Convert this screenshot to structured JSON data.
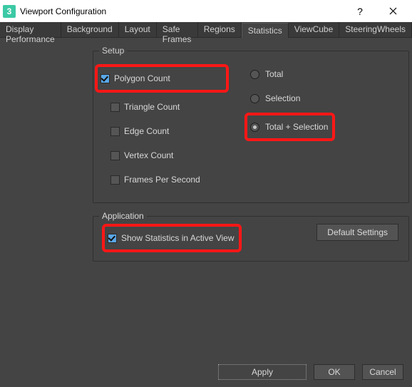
{
  "window": {
    "title": "Viewport Configuration"
  },
  "tabs": {
    "display_performance": "Display Performance",
    "background": "Background",
    "layout": "Layout",
    "safe_frames": "Safe Frames",
    "regions": "Regions",
    "statistics": "Statistics",
    "viewcube": "ViewCube",
    "steeringwheels": "SteeringWheels",
    "active": "statistics"
  },
  "setup": {
    "legend": "Setup",
    "polygon_count": "Polygon Count",
    "triangle_count": "Triangle Count",
    "edge_count": "Edge Count",
    "vertex_count": "Vertex Count",
    "fps": "Frames Per Second",
    "total": "Total",
    "selection": "Selection",
    "total_selection": "Total + Selection",
    "checked": {
      "polygon_count": true,
      "triangle_count": false,
      "edge_count": false,
      "vertex_count": false,
      "fps": false
    },
    "radio_selected": "total_selection"
  },
  "application": {
    "legend": "Application",
    "show_stats": "Show Statistics in Active View",
    "show_stats_checked": true,
    "default_settings": "Default Settings"
  },
  "buttons": {
    "apply": "Apply",
    "ok": "OK",
    "cancel": "Cancel"
  },
  "colors": {
    "highlight": "#ff1716",
    "accent": "#5aa7e6"
  }
}
